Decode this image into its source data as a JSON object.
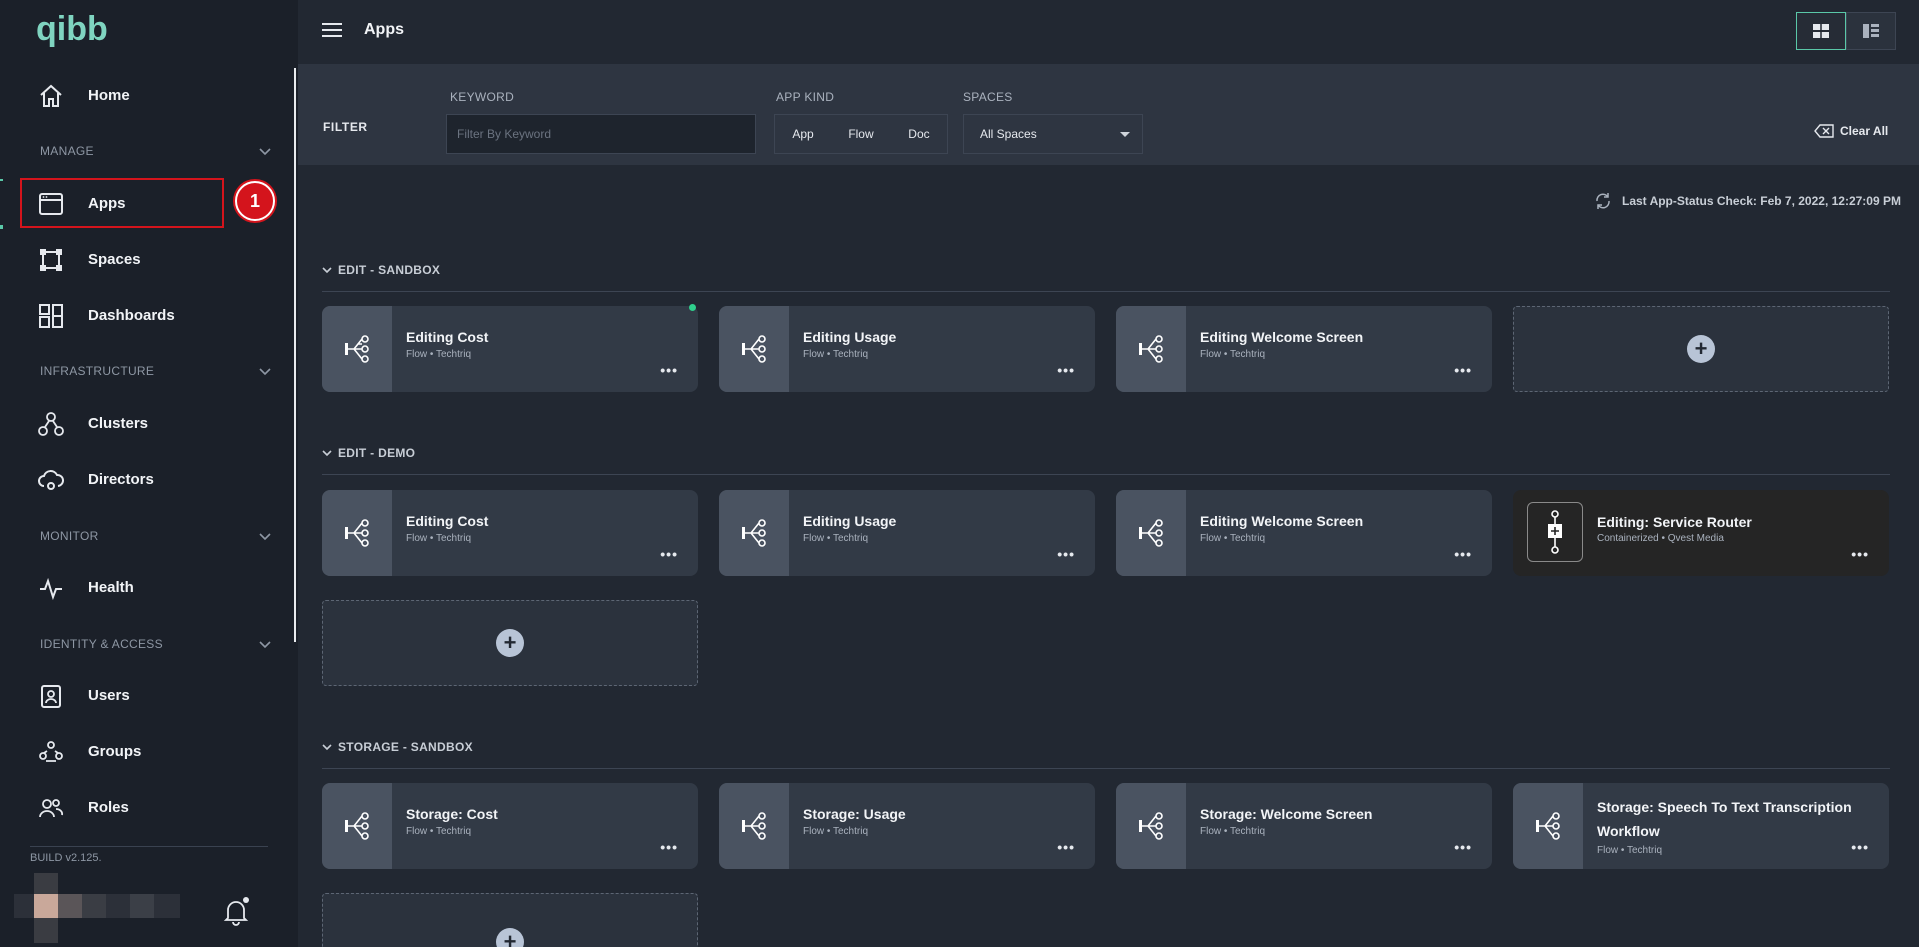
{
  "sidebar": {
    "logo_text": "qibb",
    "items": {
      "home": "Home",
      "apps": "Apps",
      "spaces": "Spaces",
      "dashboards": "Dashboards",
      "clusters": "Clusters",
      "directors": "Directors",
      "health": "Health",
      "users": "Users",
      "groups": "Groups",
      "roles": "Roles"
    },
    "sections": {
      "manage": "MANAGE",
      "infrastructure": "INFRASTRUCTURE",
      "monitor": "MONITOR",
      "identity": "IDENTITY & ACCESS"
    },
    "build": "BUILD v2.125.",
    "callout_number": "1"
  },
  "topbar": {
    "title": "Apps"
  },
  "filter": {
    "title": "FILTER",
    "keyword_label": "KEYWORD",
    "keyword_placeholder": "Filter By Keyword",
    "app_kind_label": "APP KIND",
    "kinds": [
      "App",
      "Flow",
      "Doc"
    ],
    "spaces_label": "SPACES",
    "spaces_value": "All Spaces",
    "clear_all": "Clear All"
  },
  "status": {
    "last_check": "Last App-Status Check: Feb 7, 2022, 12:27:09 PM"
  },
  "groups": [
    {
      "title": "EDIT - SANDBOX",
      "cards": [
        {
          "title": "Editing Cost",
          "sub": "Flow • Techtriq"
        },
        {
          "title": "Editing Usage",
          "sub": "Flow • Techtriq"
        },
        {
          "title": "Editing Welcome Screen",
          "sub": "Flow • Techtriq"
        }
      ]
    },
    {
      "title": "EDIT - DEMO",
      "cards": [
        {
          "title": "Editing Cost",
          "sub": "Flow • Techtriq"
        },
        {
          "title": "Editing Usage",
          "sub": "Flow • Techtriq"
        },
        {
          "title": "Editing Welcome Screen",
          "sub": "Flow • Techtriq"
        },
        {
          "title": "Editing: Service Router",
          "sub": "Containerized • Qvest Media"
        }
      ]
    },
    {
      "title": "STORAGE - SANDBOX",
      "cards": [
        {
          "title": "Storage: Cost",
          "sub": "Flow • Techtriq"
        },
        {
          "title": "Storage: Usage",
          "sub": "Flow • Techtriq"
        },
        {
          "title": "Storage: Welcome Screen",
          "sub": "Flow • Techtriq"
        },
        {
          "title": "Storage: Speech To Text Transcription Workflow",
          "sub": "Flow • Techtriq"
        }
      ]
    }
  ],
  "card_menu_label": "•••",
  "add_label": "+"
}
